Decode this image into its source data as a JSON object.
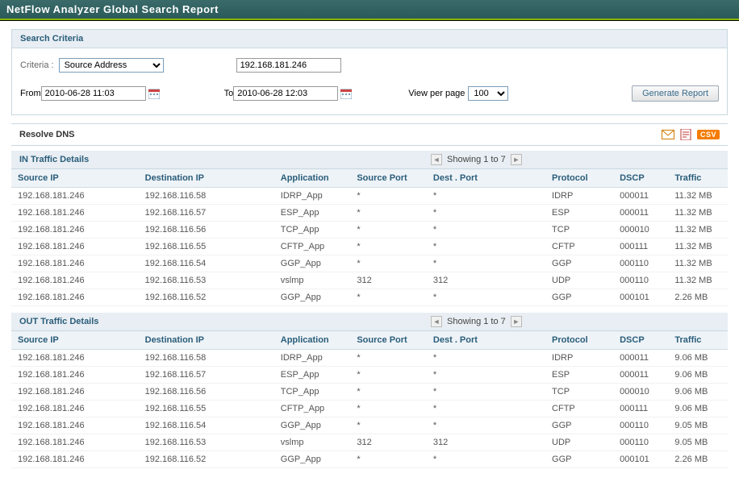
{
  "title": "NetFlow Analyzer Global Search Report",
  "searchCriteria": {
    "header": "Search Criteria",
    "criteriaLabel": "Criteria :",
    "criteriaSelected": "Source Address",
    "criteriaValue": "192.168.181.246",
    "fromLabel": "From",
    "fromValue": "2010-06-28 11:03",
    "toLabel": "To",
    "toValue": "2010-06-28 12:03",
    "viewPerPageLabel": "View per page",
    "viewPerPageSelected": "100",
    "generateButton": "Generate Report"
  },
  "resolveDnsLabel": "Resolve DNS",
  "exports": {
    "csvLabel": "CSV"
  },
  "columns": {
    "sourceIp": "Source IP",
    "destIp": "Destination IP",
    "application": "Application",
    "srcPort": "Source Port",
    "dstPort": "Dest . Port",
    "protocol": "Protocol",
    "dscp": "DSCP",
    "traffic": "Traffic"
  },
  "in": {
    "header": "IN Traffic Details",
    "pager": "Showing 1 to 7",
    "rows": [
      {
        "src": "192.168.181.246",
        "dst": "192.168.116.58",
        "app": "IDRP_App",
        "sp": "*",
        "dp": "*",
        "proto": "IDRP",
        "dscp": "000011",
        "tfc": "11.32 MB"
      },
      {
        "src": "192.168.181.246",
        "dst": "192.168.116.57",
        "app": "ESP_App",
        "sp": "*",
        "dp": "*",
        "proto": "ESP",
        "dscp": "000011",
        "tfc": "11.32 MB"
      },
      {
        "src": "192.168.181.246",
        "dst": "192.168.116.56",
        "app": "TCP_App",
        "sp": "*",
        "dp": "*",
        "proto": "TCP",
        "dscp": "000010",
        "tfc": "11.32 MB"
      },
      {
        "src": "192.168.181.246",
        "dst": "192.168.116.55",
        "app": "CFTP_App",
        "sp": "*",
        "dp": "*",
        "proto": "CFTP",
        "dscp": "000111",
        "tfc": "11.32 MB"
      },
      {
        "src": "192.168.181.246",
        "dst": "192.168.116.54",
        "app": "GGP_App",
        "sp": "*",
        "dp": "*",
        "proto": "GGP",
        "dscp": "000110",
        "tfc": "11.32 MB"
      },
      {
        "src": "192.168.181.246",
        "dst": "192.168.116.53",
        "app": "vslmp",
        "sp": "312",
        "dp": "312",
        "proto": "UDP",
        "dscp": "000110",
        "tfc": "11.32 MB"
      },
      {
        "src": "192.168.181.246",
        "dst": "192.168.116.52",
        "app": "GGP_App",
        "sp": "*",
        "dp": "*",
        "proto": "GGP",
        "dscp": "000101",
        "tfc": "2.26 MB"
      }
    ]
  },
  "out": {
    "header": "OUT Traffic Details",
    "pager": "Showing 1 to 7",
    "rows": [
      {
        "src": "192.168.181.246",
        "dst": "192.168.116.58",
        "app": "IDRP_App",
        "sp": "*",
        "dp": "*",
        "proto": "IDRP",
        "dscp": "000011",
        "tfc": "9.06 MB"
      },
      {
        "src": "192.168.181.246",
        "dst": "192.168.116.57",
        "app": "ESP_App",
        "sp": "*",
        "dp": "*",
        "proto": "ESP",
        "dscp": "000011",
        "tfc": "9.06 MB"
      },
      {
        "src": "192.168.181.246",
        "dst": "192.168.116.56",
        "app": "TCP_App",
        "sp": "*",
        "dp": "*",
        "proto": "TCP",
        "dscp": "000010",
        "tfc": "9.06 MB"
      },
      {
        "src": "192.168.181.246",
        "dst": "192.168.116.55",
        "app": "CFTP_App",
        "sp": "*",
        "dp": "*",
        "proto": "CFTP",
        "dscp": "000111",
        "tfc": "9.06 MB"
      },
      {
        "src": "192.168.181.246",
        "dst": "192.168.116.54",
        "app": "GGP_App",
        "sp": "*",
        "dp": "*",
        "proto": "GGP",
        "dscp": "000110",
        "tfc": "9.05 MB"
      },
      {
        "src": "192.168.181.246",
        "dst": "192.168.116.53",
        "app": "vslmp",
        "sp": "312",
        "dp": "312",
        "proto": "UDP",
        "dscp": "000110",
        "tfc": "9.05 MB"
      },
      {
        "src": "192.168.181.246",
        "dst": "192.168.116.52",
        "app": "GGP_App",
        "sp": "*",
        "dp": "*",
        "proto": "GGP",
        "dscp": "000101",
        "tfc": "2.26 MB"
      }
    ]
  }
}
